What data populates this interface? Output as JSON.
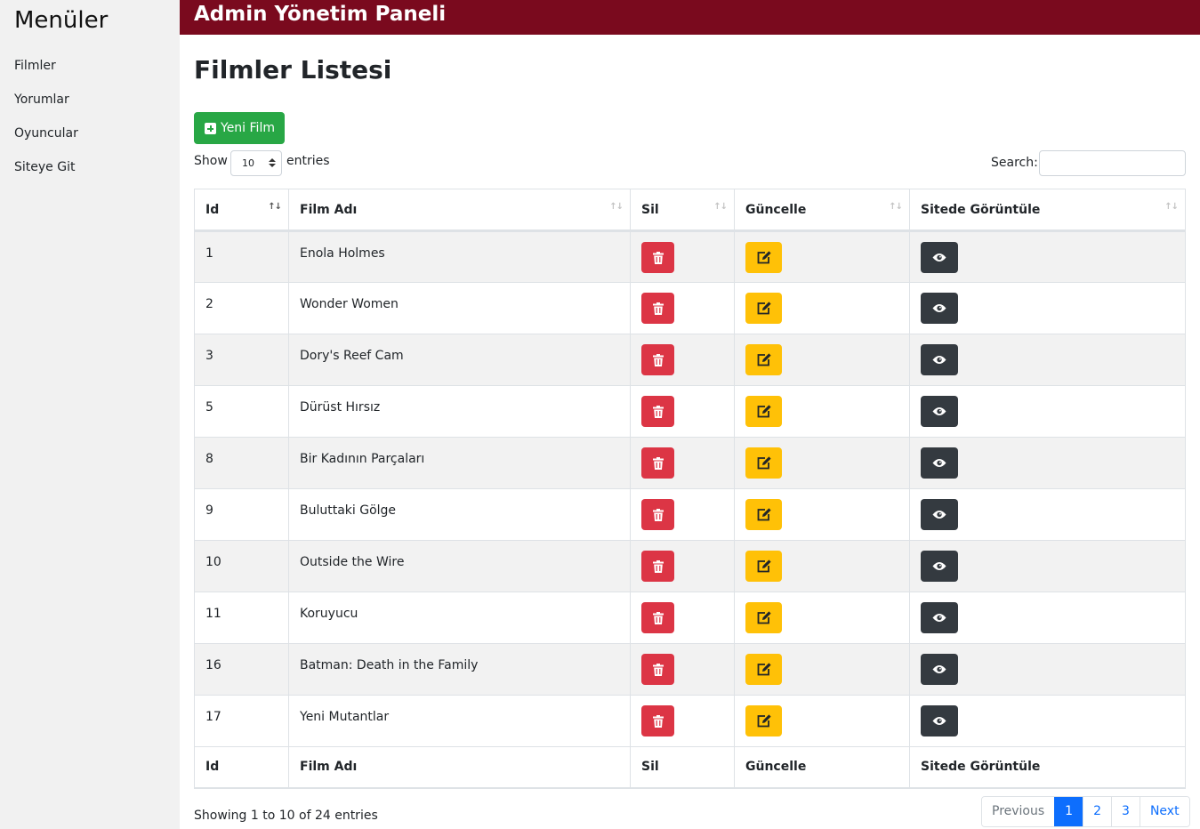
{
  "sidebar": {
    "title": "Menüler",
    "items": [
      {
        "label": "Filmler"
      },
      {
        "label": "Yorumlar"
      },
      {
        "label": "Oyuncular"
      },
      {
        "label": "Siteye Git"
      }
    ]
  },
  "header": {
    "title": "Admin Yönetim Paneli"
  },
  "page": {
    "title": "Filmler Listesi",
    "new_button": "Yeni Film"
  },
  "length_control": {
    "prefix": "Show",
    "value": "10",
    "suffix": "entries"
  },
  "search": {
    "label": "Search:",
    "value": ""
  },
  "table": {
    "columns": [
      "Id",
      "Film Adı",
      "Sil",
      "Güncelle",
      "Sitede Görüntüle"
    ],
    "rows": [
      {
        "id": "1",
        "name": "Enola Holmes"
      },
      {
        "id": "2",
        "name": "Wonder Women"
      },
      {
        "id": "3",
        "name": "Dory's Reef Cam"
      },
      {
        "id": "5",
        "name": "Dürüst Hırsız"
      },
      {
        "id": "8",
        "name": "Bir Kadının Parçaları"
      },
      {
        "id": "9",
        "name": "Buluttaki Gölge"
      },
      {
        "id": "10",
        "name": "Outside the Wire"
      },
      {
        "id": "11",
        "name": "Koruyucu"
      },
      {
        "id": "16",
        "name": "Batman: Death in the Family"
      },
      {
        "id": "17",
        "name": "Yeni Mutantlar"
      }
    ]
  },
  "info": "Showing 1 to 10 of 24 entries",
  "pagination": {
    "previous": "Previous",
    "pages": [
      "1",
      "2",
      "3"
    ],
    "next": "Next",
    "active": "1"
  },
  "icons": {
    "delete": "trash-icon",
    "edit": "edit-icon",
    "view": "eye-icon",
    "add": "plus-square-icon"
  },
  "colors": {
    "header": "#7a0a1e",
    "add": "#28a745",
    "delete": "#dc3545",
    "edit": "#ffc107",
    "view": "#343a40",
    "page_active": "#0d6efd"
  }
}
